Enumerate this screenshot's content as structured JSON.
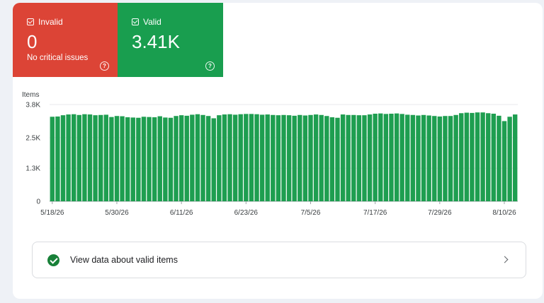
{
  "tiles": {
    "invalid": {
      "label": "Invalid",
      "value": "0",
      "subtext": "No critical issues",
      "help": "?",
      "color": "#dc4436"
    },
    "valid": {
      "label": "Valid",
      "value": "3.41K",
      "help": "?",
      "color": "#199e4f"
    }
  },
  "chart_data": {
    "type": "bar",
    "ylabel": "Items",
    "ylim": [
      0,
      3800
    ],
    "yticks": [
      "3.8K",
      "2.5K",
      "1.3K",
      "0"
    ],
    "ytick_values": [
      3800,
      2500,
      1300,
      0
    ],
    "xticks": [
      "5/18/26",
      "5/30/26",
      "6/11/26",
      "6/23/26",
      "7/5/26",
      "7/17/26",
      "7/29/26",
      "8/10/26"
    ],
    "series": [
      {
        "color": "#1e9e50",
        "start": "5/18/26",
        "values": [
          3320,
          3330,
          3380,
          3410,
          3420,
          3390,
          3420,
          3410,
          3380,
          3390,
          3400,
          3310,
          3350,
          3340,
          3300,
          3290,
          3280,
          3320,
          3310,
          3300,
          3340,
          3290,
          3280,
          3350,
          3380,
          3360,
          3400,
          3420,
          3390,
          3350,
          3260,
          3380,
          3410,
          3420,
          3400,
          3420,
          3430,
          3430,
          3420,
          3400,
          3410,
          3390,
          3380,
          3390,
          3380,
          3360,
          3390,
          3370,
          3390,
          3410,
          3390,
          3350,
          3300,
          3280,
          3410,
          3390,
          3390,
          3380,
          3380,
          3410,
          3440,
          3450,
          3430,
          3440,
          3450,
          3430,
          3400,
          3390,
          3370,
          3390,
          3370,
          3350,
          3330,
          3350,
          3350,
          3390,
          3460,
          3480,
          3470,
          3490,
          3490,
          3460,
          3440,
          3360,
          3150,
          3320,
          3410
        ]
      }
    ]
  },
  "footer": {
    "view_label": "View data about valid items"
  }
}
